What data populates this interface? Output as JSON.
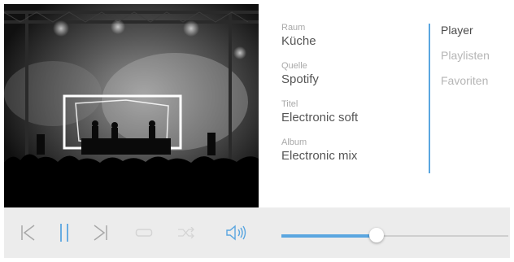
{
  "now_playing": {
    "room_label": "Raum",
    "room_value": "Küche",
    "source_label": "Quelle",
    "source_value": "Spotify",
    "title_label": "Titel",
    "title_value": "Electronic soft",
    "album_label": "Album",
    "album_value": "Electronic mix"
  },
  "nav": {
    "items": [
      {
        "label": "Player",
        "active": true
      },
      {
        "label": "Playlisten",
        "active": false
      },
      {
        "label": "Favoriten",
        "active": false
      }
    ]
  },
  "controls": {
    "icons": [
      "previous-icon",
      "pause-icon",
      "next-icon",
      "repeat-icon",
      "shuffle-icon",
      "volume-icon"
    ],
    "volume_level": 0.42
  },
  "colors": {
    "accent": "#5aa6e0",
    "control_bar": "#ececec",
    "inactive_icon": "#a8a8a8",
    "disabled_icon": "#d4d4d4"
  }
}
